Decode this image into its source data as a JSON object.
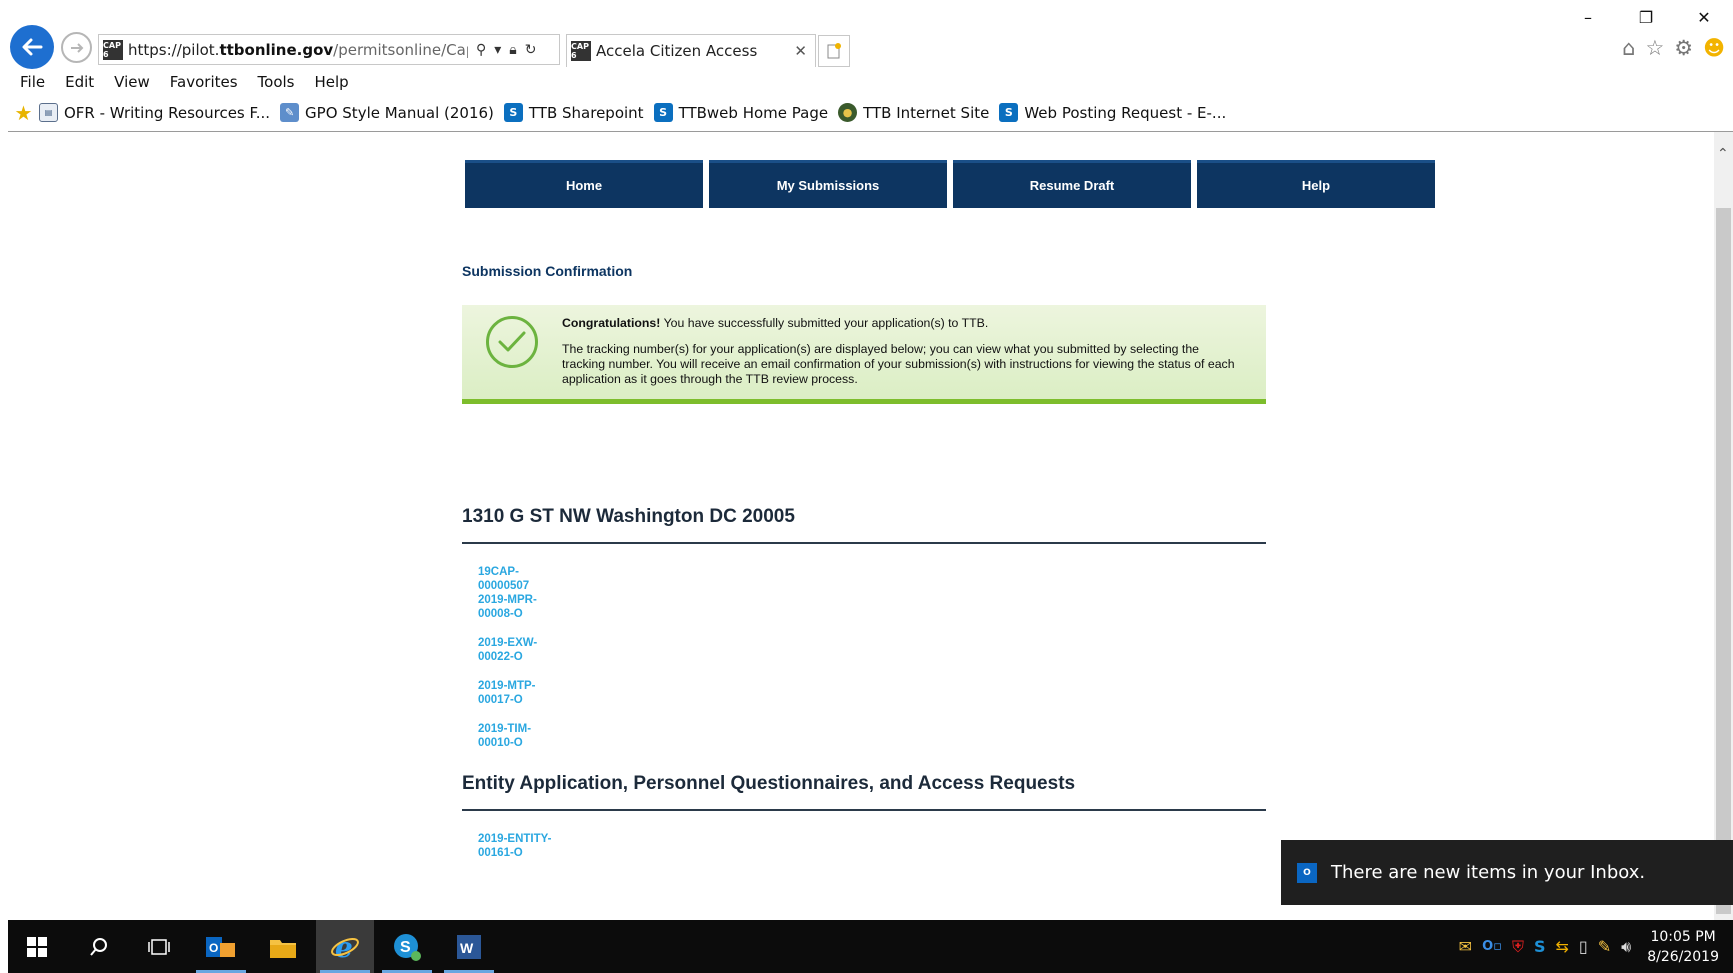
{
  "browser": {
    "url_prefix": "https://pilot.",
    "url_domain": "ttbonline.gov",
    "url_path": "/permitsonline/Cap/Cap",
    "tab_title": "Accela Citizen Access",
    "favicon_text": "CAP 6",
    "menu": [
      "File",
      "Edit",
      "View",
      "Favorites",
      "Tools",
      "Help"
    ],
    "favorites": [
      {
        "label": "OFR - Writing Resources F...",
        "icon": "document-icon"
      },
      {
        "label": "GPO Style Manual (2016)",
        "icon": "gpo-icon"
      },
      {
        "label": "TTB Sharepoint",
        "icon": "sharepoint-icon"
      },
      {
        "label": "TTBweb Home Page",
        "icon": "sharepoint-icon"
      },
      {
        "label": "TTB Internet Site",
        "icon": "seal-icon"
      },
      {
        "label": "Web Posting Request - E-...",
        "icon": "sharepoint-icon"
      }
    ]
  },
  "nav": {
    "home": "Home",
    "submissions": "My Submissions",
    "resume": "Resume Draft",
    "help": "Help"
  },
  "page": {
    "heading": "Submission Confirmation",
    "congrats_bold": "Congratulations!",
    "congrats_text": " You have successfully submitted your application(s) to TTB.",
    "info_text": "The tracking number(s) for your application(s) are displayed below; you can view what you submitted by selecting the tracking number. You will receive an email confirmation of your submission(s) with instructions for viewing the status of each application as it goes through the TTB review process."
  },
  "sections": [
    {
      "title": "1310 G ST NW Washington DC 20005",
      "items": [
        "19CAP-00000507",
        "2019-MPR-00008-O",
        "2019-EXW-00022-O",
        "2019-MTP-00017-O",
        "2019-TIM-00010-O"
      ]
    },
    {
      "title": "Entity Application, Personnel Questionnaires, and Access Requests",
      "items": [
        "2019-ENTITY-00161-O"
      ]
    }
  ],
  "toast": {
    "message": "There are new items in your Inbox."
  },
  "taskbar": {
    "time": "10:05 PM",
    "date": "8/26/2019"
  },
  "colors": {
    "nav_bg": "#0d3561",
    "link": "#2aa7e0",
    "success_bar": "#7dbd2c",
    "success_bg": "#dbeec4"
  }
}
